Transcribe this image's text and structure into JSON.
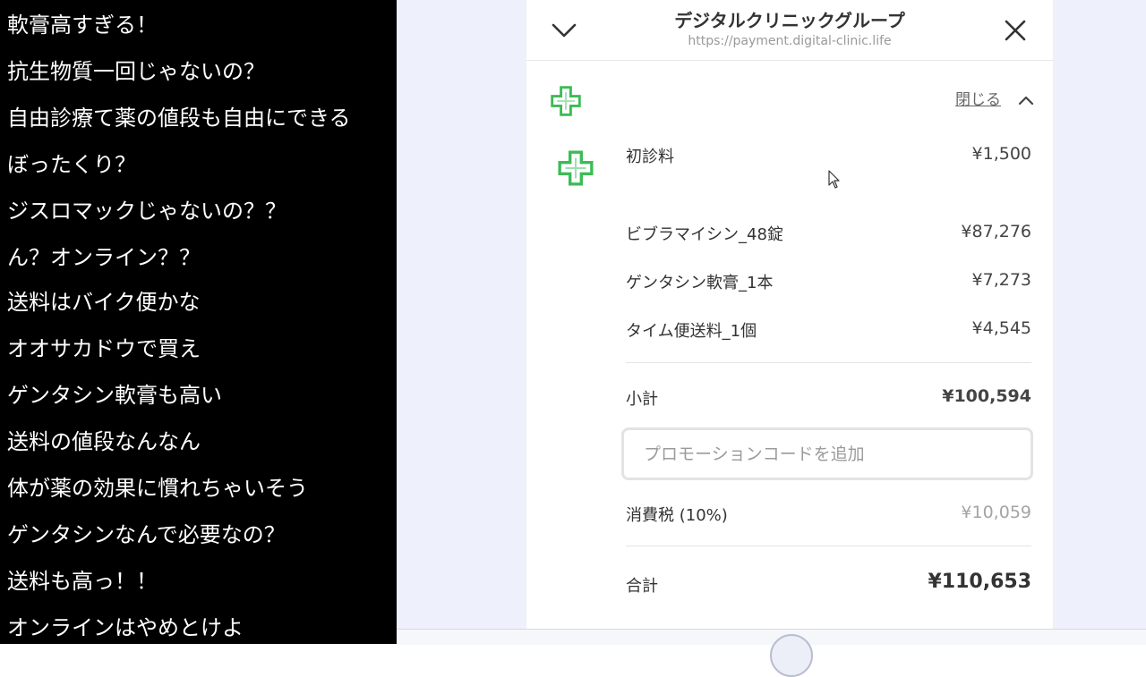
{
  "comments": [
    "軟膏高すぎる！",
    "抗生物質一回じゃないの？",
    "自由診療て薬の値段も自由にできる",
    "ぼったくり？",
    "ジスロマックじゃないの？？",
    "ん？オンライン？？",
    "送料はバイク便かな",
    "オオサカドウで買え",
    "ゲンタシン軟膏も高い",
    "送料の値段なんなん",
    "体が薬の効果に慣れちゃいそう",
    "ゲンタシンなんで必要なの？",
    "送料も高っ！！",
    "オンラインはやめとけよ"
  ],
  "header": {
    "title": "デジタルクリニックグループ",
    "url": "https://payment.digital-clinic.life"
  },
  "summary": {
    "toggle_label": "閉じる",
    "items": [
      {
        "label": "初診料",
        "price": "¥1,500"
      },
      {
        "label": "ビブラマイシン_48錠",
        "price": "¥87,276"
      },
      {
        "label": "ゲンタシン軟膏_1本",
        "price": "¥7,273"
      },
      {
        "label": "タイム便送料_1個",
        "price": "¥4,545"
      }
    ],
    "subtotal_label": "小計",
    "subtotal_value": "¥100,594",
    "promo_placeholder": "プロモーションコードを追加",
    "tax_label": "消費税 (10%)",
    "tax_value": "¥10,059",
    "total_label": "合計",
    "total_value": "¥110,653"
  },
  "colors": {
    "comment_bg": "#000000",
    "page_bg": "#eef1fb",
    "logo_green": "#3dbb57"
  }
}
